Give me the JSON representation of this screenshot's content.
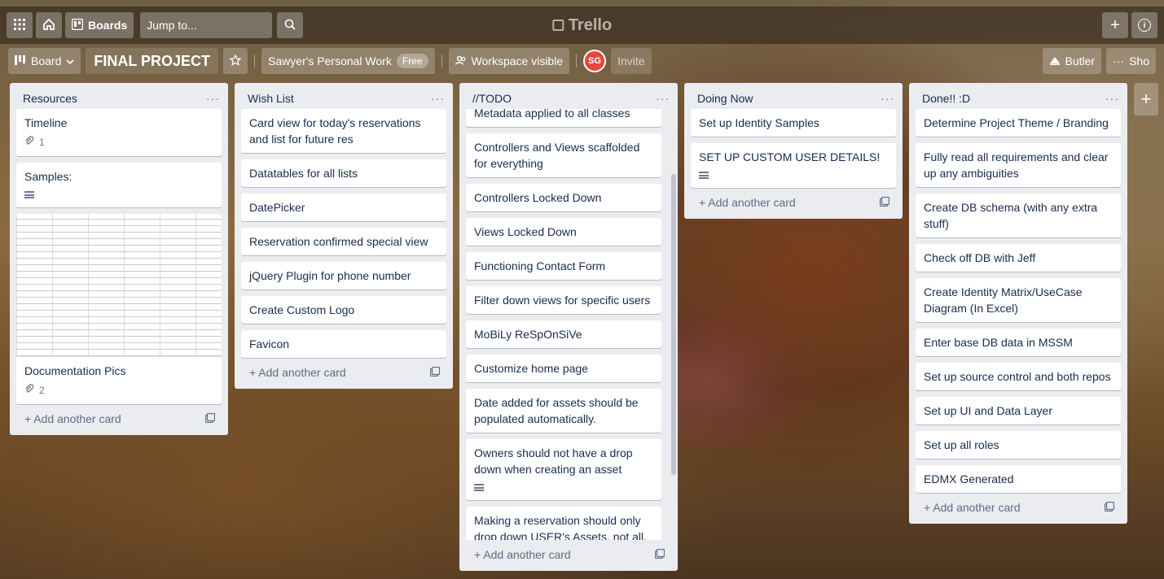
{
  "topbar": {
    "boards_label": "Boards",
    "search_placeholder": "Jump to...",
    "logo_text": "Trello",
    "plus": "+",
    "info": "i"
  },
  "boardbar": {
    "view_label": "Board",
    "board_title": "FINAL PROJECT",
    "workspace": "Sawyer's Personal Work",
    "free_badge": "Free",
    "visibility": "Workspace visible",
    "avatar_initials": "SG",
    "invite_label": "Invite",
    "butler_label": "Butler",
    "show_menu_label": "Sho"
  },
  "lists": [
    {
      "title": "Resources",
      "cards": [
        {
          "title": "Timeline",
          "attachments": "1"
        },
        {
          "title": "Samples:"
        },
        {
          "title": "Documentation Pics",
          "attachments": "2"
        }
      ]
    },
    {
      "title": "Wish List",
      "cards": [
        {
          "title": "Card view for today's reservations and list for future res"
        },
        {
          "title": "Datatables for all lists"
        },
        {
          "title": "DatePicker"
        },
        {
          "title": "Reservation confirmed special view"
        },
        {
          "title": "jQuery Plugin for phone number"
        },
        {
          "title": "Create Custom Logo"
        },
        {
          "title": "Favicon"
        }
      ]
    },
    {
      "title": "//TODO",
      "cards": [
        {
          "title": "Metadata applied to all classes"
        },
        {
          "title": "Controllers and Views scaffolded for everything"
        },
        {
          "title": "Controllers Locked Down"
        },
        {
          "title": "Views Locked Down"
        },
        {
          "title": "Functioning Contact Form"
        },
        {
          "title": "Filter down views for specific users"
        },
        {
          "title": "MoBiLy ReSpOnSiVe"
        },
        {
          "title": "Customize home page"
        },
        {
          "title": "Date added for assets should be populated automatically."
        },
        {
          "title": "Owners should not have a drop down when creating an asset"
        },
        {
          "title": "Making a reservation should only drop down USER's Assets, not all."
        }
      ]
    },
    {
      "title": "Doing Now",
      "cards": [
        {
          "title": "Set up Identity Samples"
        },
        {
          "title": "SET UP CUSTOM USER DETAILS!"
        }
      ]
    },
    {
      "title": "Done!! :D",
      "cards": [
        {
          "title": "Determine Project Theme / Branding"
        },
        {
          "title": "Fully read all requirements and clear up any ambiguities"
        },
        {
          "title": "Create DB schema (with any extra stuff)"
        },
        {
          "title": "Check off DB with Jeff"
        },
        {
          "title": "Create Identity Matrix/UseCase Diagram (In Excel)"
        },
        {
          "title": "Enter base DB data in MSSM"
        },
        {
          "title": "Set up source control and both repos"
        },
        {
          "title": "Set up UI and Data Layer"
        },
        {
          "title": "Set up all roles"
        },
        {
          "title": "EDMX Generated"
        }
      ]
    }
  ],
  "add_card_label": "+ Add another card",
  "list_menu": "···",
  "add_list": "+",
  "colors": {
    "list_bg": "#ebecf0",
    "avatar": "#e5483b",
    "card_text": "#172b4d"
  }
}
